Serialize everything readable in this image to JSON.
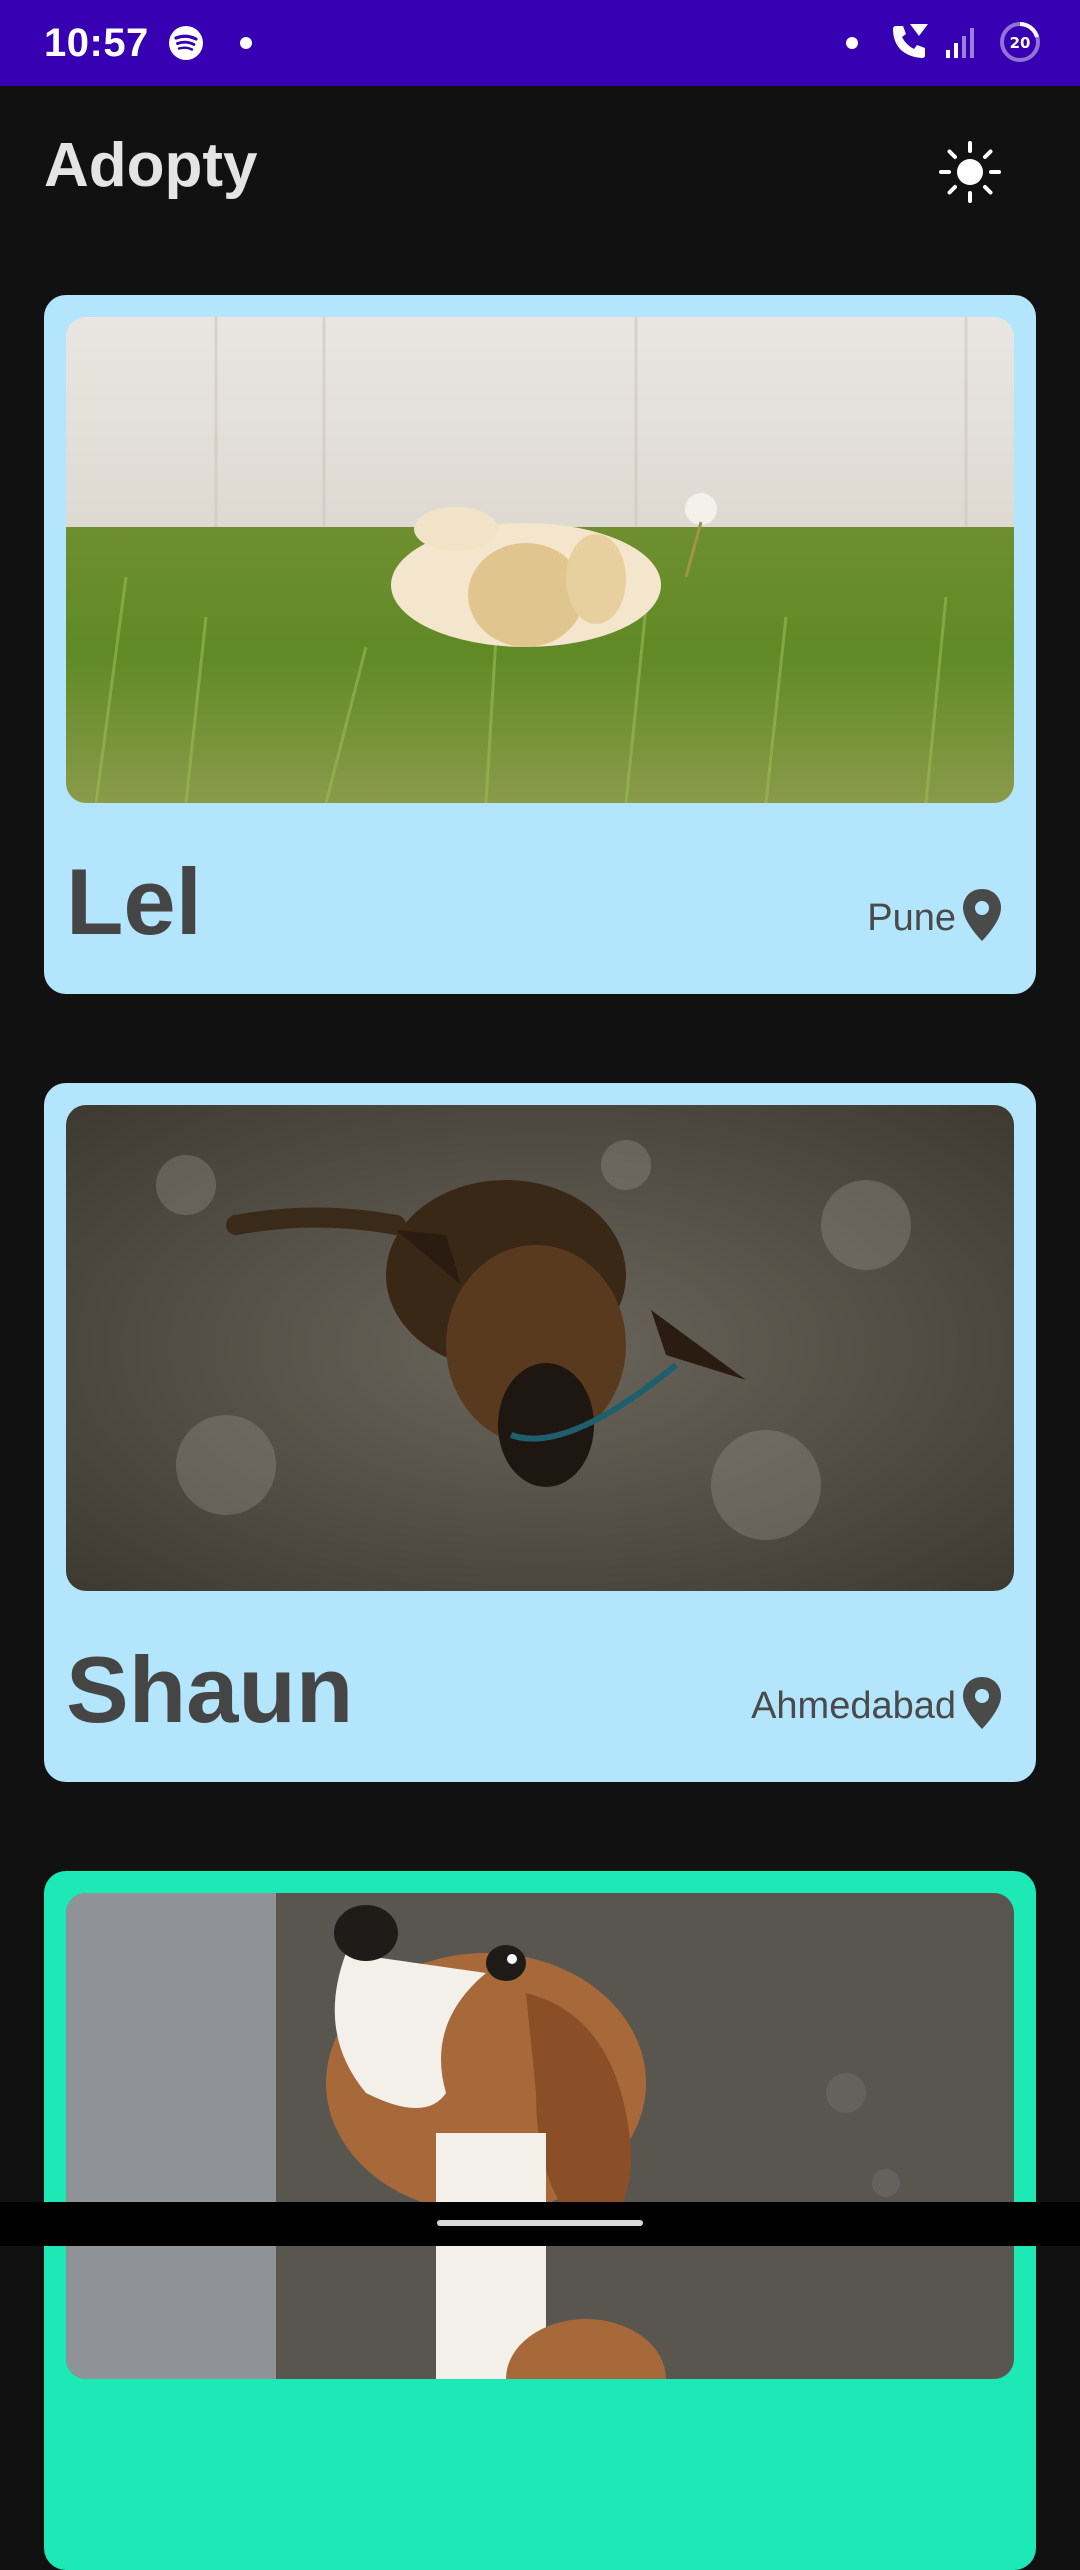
{
  "status_bar": {
    "time": "10:57",
    "battery_level": "20",
    "icons": [
      "spotify-icon",
      "notification-dot-icon",
      "wifi-calling-icon",
      "cell-signal-icon",
      "battery-saver-icon"
    ]
  },
  "app_bar": {
    "title": "Adopty",
    "theme_toggle_icon": "sun-icon"
  },
  "pets": [
    {
      "name": "Lel",
      "location": "Pune",
      "photo": "cream puppy lying in grass",
      "card_color": "#b3e5fc"
    },
    {
      "name": "Shaun",
      "location": "Ahmedabad",
      "photo": "wet brown-black puppy shaking off water",
      "card_color": "#b3e5fc"
    },
    {
      "name": "",
      "location": "",
      "photo": "beagle puppy looking up",
      "card_color": "#1de9b6"
    }
  ],
  "colors": {
    "status_bar": "#3700b3",
    "background": "#111111",
    "card": "#b3e5fc",
    "card_accent": "#1de9b6",
    "text_dark": "#454545"
  }
}
